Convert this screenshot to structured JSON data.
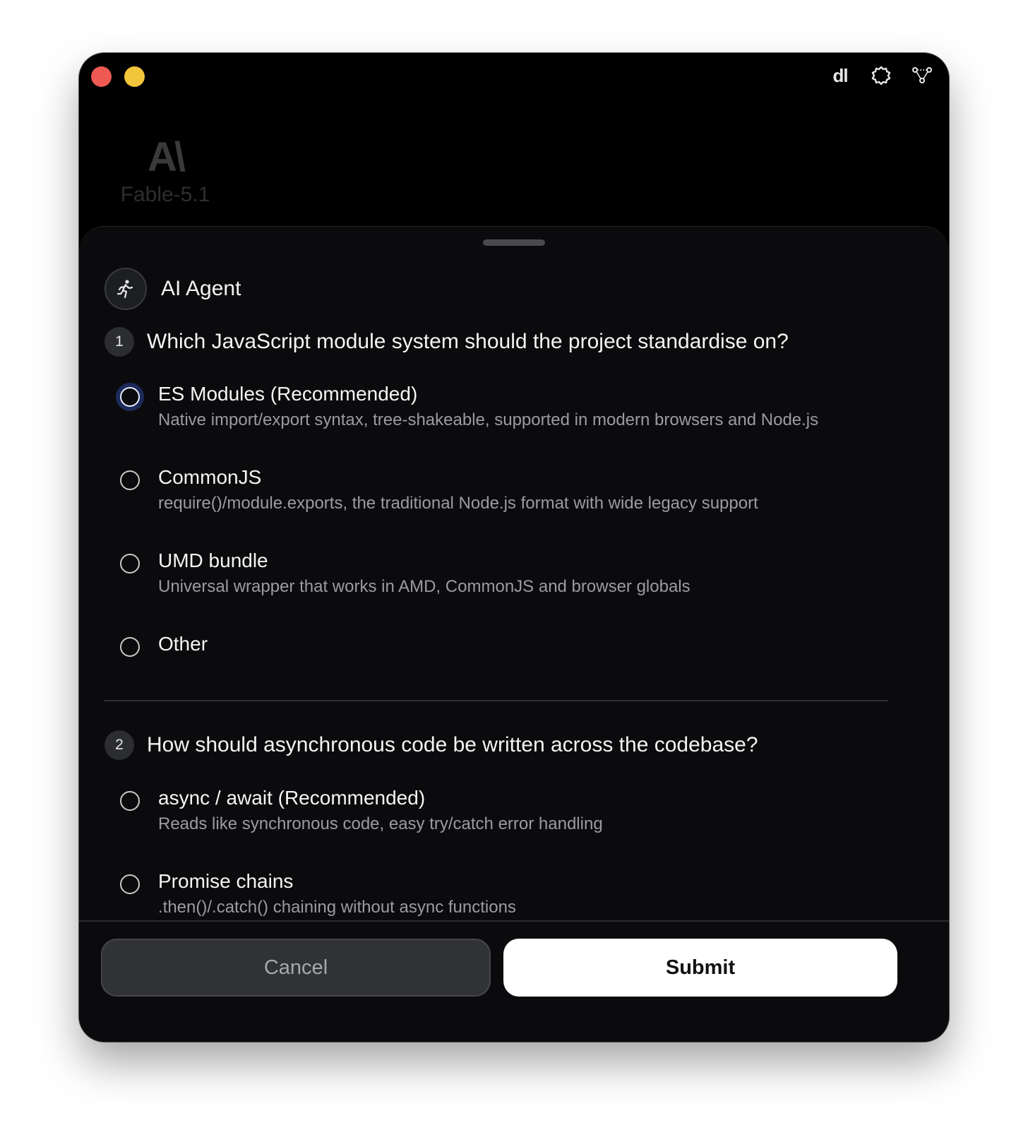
{
  "titlebar": {
    "dl_label": "dl",
    "icons": [
      "dl-icon",
      "gear-icon",
      "network-icon"
    ]
  },
  "brand": {
    "logo": "A\\",
    "model_name": "Fable-5.1"
  },
  "agent": {
    "name": "AI Agent",
    "icon": "running-person-icon"
  },
  "questions": [
    {
      "number": "1",
      "text": "Which JavaScript module system should the project standardise on?",
      "options": [
        {
          "title": "ES Modules (Recommended)",
          "description": "Native import/export syntax, tree-shakeable, supported in modern browsers and Node.js"
        },
        {
          "title": "CommonJS",
          "description": "require()/module.exports, the traditional Node.js format with wide legacy support"
        },
        {
          "title": "UMD bundle",
          "description": "Universal wrapper that works in AMD, CommonJS and browser globals"
        },
        {
          "title": "Other",
          "description": ""
        }
      ]
    },
    {
      "number": "2",
      "text": "How should asynchronous code be written across the codebase?",
      "options": [
        {
          "title": "async / await (Recommended)",
          "description": "Reads like synchronous code, easy try/catch error handling"
        },
        {
          "title": "Promise chains",
          "description": ".then()/.catch() chaining without async functions"
        }
      ]
    }
  ],
  "footer": {
    "cancel_label": "Cancel",
    "submit_label": "Submit"
  },
  "colors": {
    "close": "#ee5a53",
    "minimize": "#f2c53a",
    "focus_ring": "#1c2a5a"
  }
}
